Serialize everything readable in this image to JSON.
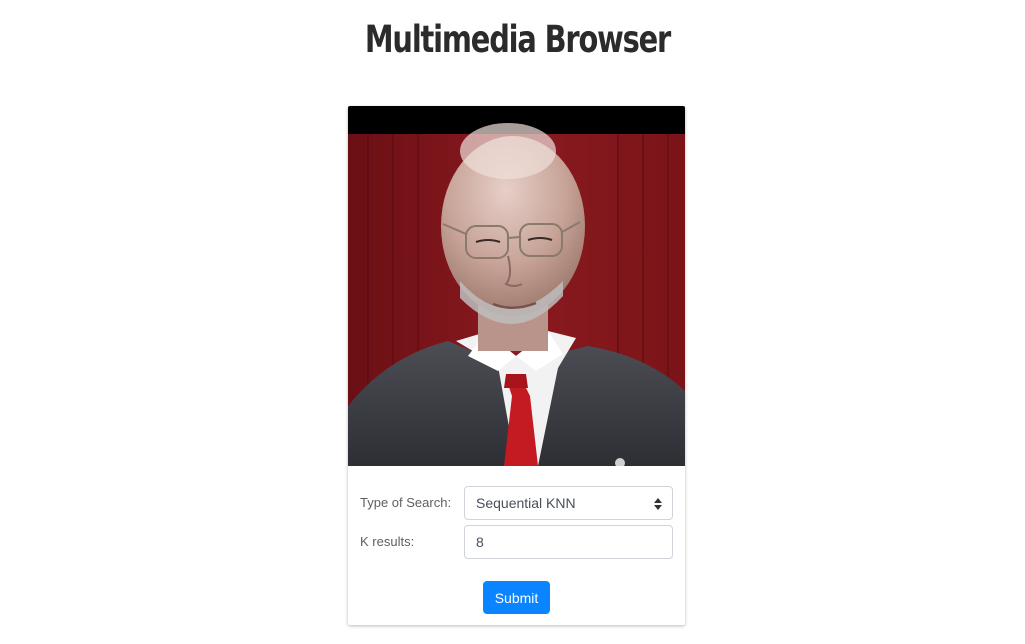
{
  "header": {
    "title": "Multimedia Browser"
  },
  "card": {
    "image_alt": "Query face image",
    "form": {
      "search_type_label": "Type of Search:",
      "search_type_selected": "Sequential KNN",
      "k_label": "K results:",
      "k_value": "8",
      "submit_label": "Submit"
    }
  },
  "colors": {
    "submit_button": "#0a84ff",
    "photo_background": "#7a1418"
  },
  "icons": {
    "select_caret": "up-down-caret-icon"
  }
}
